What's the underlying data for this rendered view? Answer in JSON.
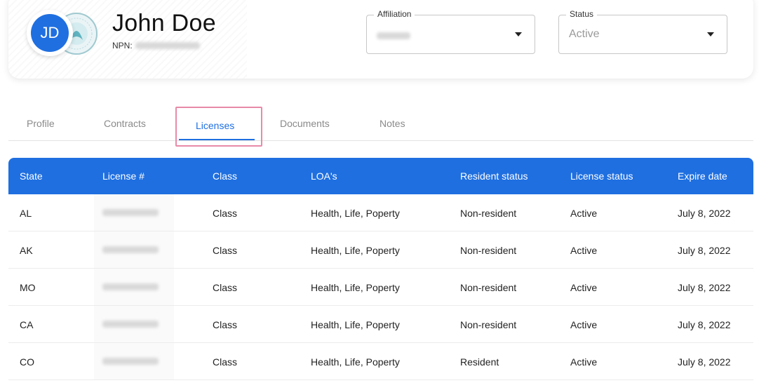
{
  "profile": {
    "initials": "JD",
    "name": "John Doe",
    "npn_label": "NPN:"
  },
  "filters": {
    "affiliation": {
      "label": "Affiliation"
    },
    "status": {
      "label": "Status",
      "value": "Active"
    }
  },
  "tabs": [
    {
      "label": "Profile"
    },
    {
      "label": "Contracts"
    },
    {
      "label": "Licenses",
      "active": true
    },
    {
      "label": "Documents"
    },
    {
      "label": "Notes"
    }
  ],
  "table": {
    "headers": [
      "State",
      "License #",
      "Class",
      "LOA's",
      "Resident status",
      "License status",
      "Expire date"
    ],
    "rows": [
      {
        "state": "AL",
        "class": "Class",
        "loa": "Health, Life,  Poperty",
        "resident": "Non-resident",
        "status": "Active",
        "expire": "July 8, 2022"
      },
      {
        "state": "AK",
        "class": "Class",
        "loa": "Health, Life,  Poperty",
        "resident": "Non-resident",
        "status": "Active",
        "expire": "July 8, 2022"
      },
      {
        "state": "MO",
        "class": "Class",
        "loa": "Health, Life,  Poperty",
        "resident": "Non-resident",
        "status": "Active",
        "expire": "July 8, 2022"
      },
      {
        "state": "CA",
        "class": "Class",
        "loa": "Health, Life,  Poperty",
        "resident": "Non-resident",
        "status": "Active",
        "expire": "July 8, 2022"
      },
      {
        "state": "CO",
        "class": "Class",
        "loa": "Health, Life,  Poperty",
        "resident": "Resident",
        "status": "Active",
        "expire": "July 8, 2022"
      }
    ]
  },
  "colors": {
    "accent": "#1f6fe0",
    "highlight": "#e88aa8"
  }
}
